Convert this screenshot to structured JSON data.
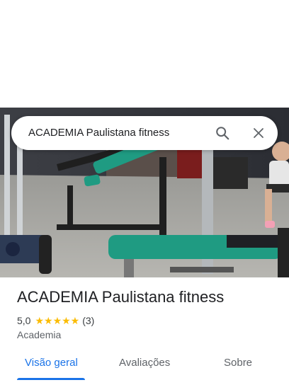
{
  "search": {
    "query": "ACADEMIA Paulistana fitness"
  },
  "icons": {
    "search": "search-icon",
    "close": "close-icon",
    "star": "star-icon"
  },
  "place": {
    "title": "ACADEMIA Paulistana fitness",
    "rating": "5,0",
    "stars": "★★★★★",
    "review_count": "(3)",
    "category": "Academia"
  },
  "tabs": [
    {
      "label": "Visão geral",
      "active": true
    },
    {
      "label": "Avaliações",
      "active": false
    },
    {
      "label": "Sobre",
      "active": false
    }
  ],
  "colors": {
    "accent": "#1a73e8",
    "star": "#fbbc04",
    "bench_teal": "#1f9b82"
  }
}
